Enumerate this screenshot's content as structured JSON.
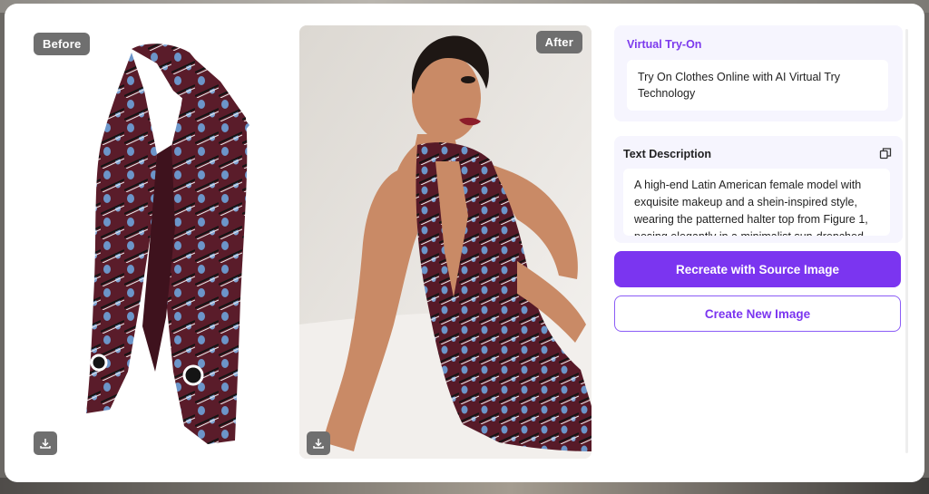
{
  "before": {
    "badge": "Before",
    "image": "patterned-halter-top-product",
    "download_icon": "download-icon"
  },
  "after": {
    "badge": "After",
    "image": "model-wearing-halter-top",
    "download_icon": "download-icon"
  },
  "virtual_tryon": {
    "title": "Virtual Try-On",
    "text": "Try On Clothes Online with AI Virtual Try Technology"
  },
  "description": {
    "title": "Text Description",
    "copy_icon": "copy-icon",
    "text": "A high-end Latin American female model with exquisite makeup and a shein-inspired style, wearing the patterned halter top from Figure 1, posing elegantly in a minimalist sun-drenched"
  },
  "actions": {
    "recreate_label": "Recreate with Source Image",
    "create_label": "Create New Image"
  },
  "colors": {
    "accent": "#7b35f0",
    "panel_bg": "#f6f5fe",
    "badge_bg": "#6f6f6f"
  }
}
